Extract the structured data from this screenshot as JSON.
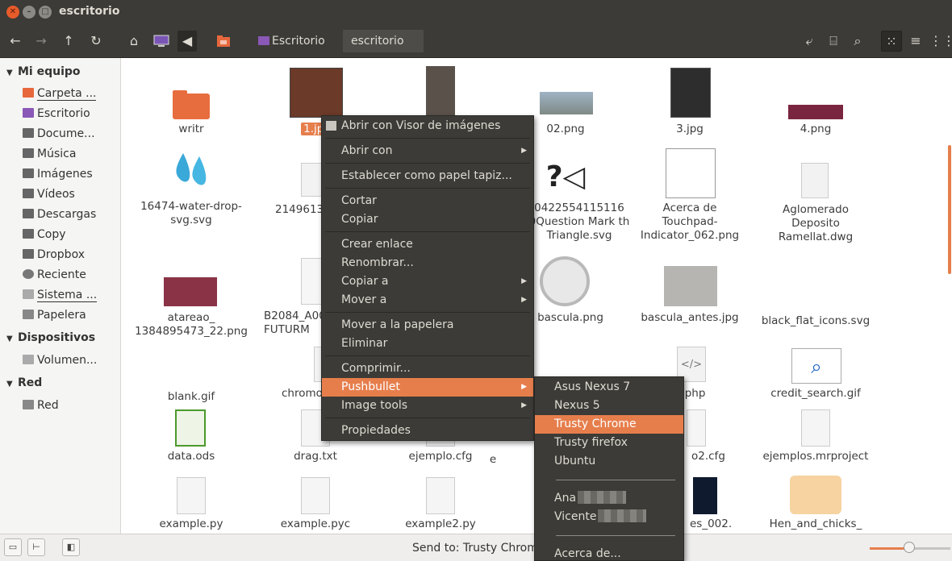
{
  "window": {
    "title": "escritorio"
  },
  "toolbar": {
    "crumbs": [
      "Escritorio",
      "escritorio"
    ]
  },
  "sidebar": {
    "sections": [
      {
        "title": "Mi equipo",
        "items": [
          "Carpeta ...",
          "Escritorio",
          "Docume...",
          "Música",
          "Imágenes",
          "Vídeos",
          "Descargas",
          "Copy",
          "Dropbox",
          "Reciente",
          "Sistema ...",
          "Papelera"
        ]
      },
      {
        "title": "Dispositivos",
        "items": [
          "Volumen..."
        ]
      },
      {
        "title": "Red",
        "items": [
          "Red"
        ]
      }
    ]
  },
  "files": [
    {
      "name": "writr",
      "icon": "folder-icon"
    },
    {
      "name": "1.jpg",
      "icon": "image-thumb",
      "selected": true
    },
    {
      "name": "",
      "icon": "image-thumb"
    },
    {
      "name": "02.png",
      "icon": "image-thumb"
    },
    {
      "name": "3.jpg",
      "icon": "image-thumb"
    },
    {
      "name": "4.png",
      "icon": "image-thumb"
    },
    {
      "name": "16474-water-drop-svg.svg",
      "icon": "water-drop-icon"
    },
    {
      "name": "2149613",
      "icon": "document-icon"
    },
    {
      "name": "0422554115116 0Question Mark th Triangle.svg",
      "icon": "question-mark-icon"
    },
    {
      "name": "Acerca de Touchpad-Indicator_062.png",
      "icon": "image-thumb"
    },
    {
      "name": "Aglomerado Deposito Ramellat.dwg",
      "icon": "document-icon"
    },
    {
      "name": "atareao_ 1384895473_22.png",
      "icon": "image-thumb"
    },
    {
      "name": "B2084_A00 FUTURM",
      "icon": "document-icon"
    },
    {
      "name": "bascula.png",
      "icon": "scale-icon"
    },
    {
      "name": "bascula_antes.jpg",
      "icon": "image-thumb"
    },
    {
      "name": "black_flat_icons.svg",
      "icon": "image-thumb"
    },
    {
      "name": "blank.gif",
      "icon": "image-thumb"
    },
    {
      "name": "chromo",
      "icon": "document-icon"
    },
    {
      "name": "c.php",
      "icon": "code-icon"
    },
    {
      "name": "credit_search.gif",
      "icon": "search-thumb"
    },
    {
      "name": "data.ods",
      "icon": "spreadsheet-icon"
    },
    {
      "name": "drag.txt",
      "icon": "text-icon"
    },
    {
      "name": "ejemplo.cfg",
      "icon": "text-icon"
    },
    {
      "name": "e",
      "icon": "text-icon"
    },
    {
      "name": "o2.cfg",
      "icon": "text-icon"
    },
    {
      "name": "ejemplos.mrproject",
      "icon": "text-icon"
    },
    {
      "name": "example.py",
      "icon": "text-icon"
    },
    {
      "name": "example.pyc",
      "icon": "python-icon"
    },
    {
      "name": "example2.py",
      "icon": "text-icon"
    },
    {
      "name": "es_002.",
      "icon": "image-thumb"
    },
    {
      "name": "Hen_and_chicks_",
      "icon": "hen-thumb"
    }
  ],
  "context_menu": {
    "items": [
      {
        "label": "Abrir con Visor de imágenes"
      },
      {
        "label": "Abrir con",
        "submenu": true
      },
      {
        "label": "Establecer como papel tapiz..."
      },
      {
        "label": "Cortar"
      },
      {
        "label": "Copiar"
      },
      {
        "label": "Crear enlace"
      },
      {
        "label": "Renombrar..."
      },
      {
        "label": "Copiar a",
        "submenu": true
      },
      {
        "label": "Mover a",
        "submenu": true
      },
      {
        "label": "Mover a la papelera"
      },
      {
        "label": "Eliminar"
      },
      {
        "label": "Comprimir..."
      },
      {
        "label": "Pushbullet",
        "submenu": true,
        "highlighted": true
      },
      {
        "label": "Image tools",
        "submenu": true
      },
      {
        "label": "Propiedades"
      }
    ]
  },
  "pushbullet_menu": {
    "items": [
      {
        "label": "Asus Nexus 7"
      },
      {
        "label": "Nexus 5"
      },
      {
        "label": "Trusty Chrome",
        "highlighted": true
      },
      {
        "label": "Trusty firefox"
      },
      {
        "label": "Ubuntu"
      },
      {
        "label": "Ana",
        "redacted": true
      },
      {
        "label": "Vicente",
        "redacted": true
      },
      {
        "label": "Acerca de..."
      }
    ]
  },
  "status": {
    "text": "Send to: Trusty Chrome"
  },
  "zoom": {
    "level": 0.45
  },
  "colors": {
    "accent": "#e67e4c",
    "chrome": "#3c3b37"
  }
}
